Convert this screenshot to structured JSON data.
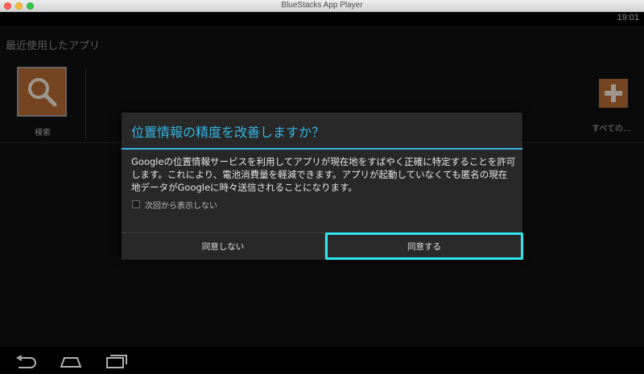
{
  "window": {
    "title": "BlueStacks App Player"
  },
  "status_bar": {
    "time": "19:01"
  },
  "home": {
    "recent_apps_title": "最近使用したアプリ",
    "search_app_label": "検索",
    "all_apps_label": "すべての..."
  },
  "dialog": {
    "title": "位置情報の精度を改善しますか？",
    "message": "Googleの位置情報サービスを利用してアプリが現在地をすばやく正確に特定することを許可します。これにより、電池消費量を軽減できます。アプリが起動していなくても匿名の現在地データがGoogleに時々送信されることになります。",
    "checkbox_label": "次回から表示しない",
    "checkbox_checked": false,
    "decline_label": "同意しない",
    "agree_label": "同意する"
  },
  "navigation": {
    "back": "back-icon",
    "home": "home-icon",
    "recents": "recents-icon"
  },
  "colors": {
    "accent": "#33b5e5",
    "focus_outline": "#2ee6f0",
    "app_tile": "#b46a34"
  }
}
